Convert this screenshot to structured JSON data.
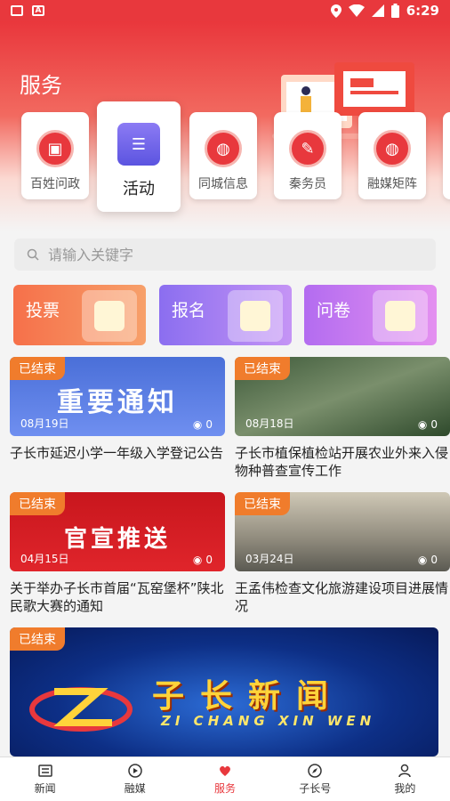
{
  "status_bar": {
    "time": "6:29"
  },
  "header": {
    "title": "服务"
  },
  "services": [
    {
      "label": "百姓问政",
      "icon": "document-a-icon"
    },
    {
      "label": "活动",
      "icon": "list-board-icon",
      "active": true
    },
    {
      "label": "同城信息",
      "icon": "globe-icon"
    },
    {
      "label": "秦务员",
      "icon": "notebook-icon"
    },
    {
      "label": "融媒矩阵",
      "icon": "globe-icon"
    }
  ],
  "search": {
    "placeholder": "请输入关键字"
  },
  "promos": [
    {
      "label": "投票",
      "color": "#f6704a"
    },
    {
      "label": "报名",
      "color": "#8b6ef0"
    },
    {
      "label": "问卷",
      "color": "#b36cf0"
    }
  ],
  "activities": [
    {
      "badge": "已结束",
      "date": "08月19日",
      "views": "0",
      "thumb_text": "重要通知",
      "title": "子长市延迟小学一年级入学登记公告"
    },
    {
      "badge": "已结束",
      "date": "08月18日",
      "views": "0",
      "thumb_text": "",
      "title": "子长市植保植检站开展农业外来入侵物种普查宣传工作"
    },
    {
      "badge": "已结束",
      "date": "04月15日",
      "views": "0",
      "thumb_text": "官宣推送",
      "title": "关于举办子长市首届“瓦窑堡杯”陕北民歌大赛的通知"
    },
    {
      "badge": "已结束",
      "date": "03月24日",
      "views": "0",
      "thumb_text": "",
      "title": "王孟伟检查文化旅游建设项目进展情况"
    }
  ],
  "featured": {
    "badge": "已结束",
    "title_cn": "子长新闻",
    "title_en": "ZI CHANG XIN WEN"
  },
  "tabbar": [
    {
      "label": "新闻",
      "icon": "newspaper-icon"
    },
    {
      "label": "融媒",
      "icon": "play-circle-icon"
    },
    {
      "label": "服务",
      "icon": "heart-hand-icon",
      "active": true
    },
    {
      "label": "子长号",
      "icon": "compass-icon"
    },
    {
      "label": "我的",
      "icon": "user-icon"
    }
  ],
  "colors": {
    "brand_red": "#e8383d",
    "badge_orange": "#f07c2c"
  }
}
